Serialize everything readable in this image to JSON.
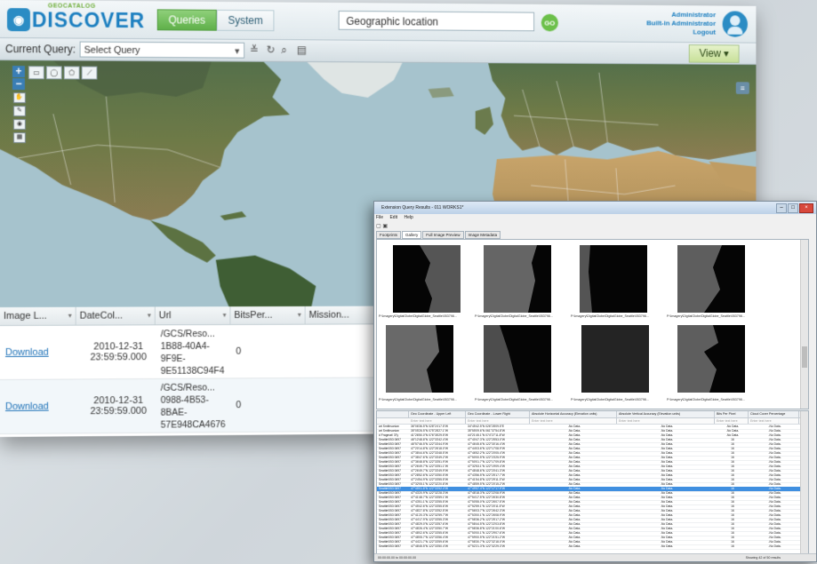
{
  "app": {
    "logo_small": "GEOCATALOG",
    "logo_main": "DISCOVER",
    "tabs": [
      {
        "label": "Queries",
        "active": true
      },
      {
        "label": "System",
        "active": false
      }
    ],
    "search_value": "Geographic location",
    "go_label": "GO",
    "user": {
      "line1": "Administrator",
      "line2": "Built-in Administrator",
      "logout": "Logout"
    }
  },
  "querybar": {
    "label": "Current Query:",
    "select_value": "Select Query",
    "view_label": "View ▾"
  },
  "grid": {
    "columns": [
      "Image L...",
      "DateCol...",
      "Url",
      "BitsPer...",
      "Mission..."
    ],
    "rows": [
      {
        "link": "Download",
        "date": "2010-12-31",
        "time": "23:59:59.000",
        "url": [
          "/GCS/Reso...",
          "1B88-40A4-",
          "9F9E-",
          "9E51138C94F4"
        ],
        "bits": "0"
      },
      {
        "link": "Download",
        "date": "2010-12-31",
        "time": "23:59:59.000",
        "url": [
          "/GCS/Reso...",
          "0988-4B53-",
          "8BAE-",
          "57E948CA4676"
        ],
        "bits": "0"
      }
    ]
  },
  "window": {
    "title": "Extension Query Results - 011 WORKS1*",
    "menu": [
      "File",
      "Edit",
      "Help"
    ],
    "tabs": [
      "Footprints",
      "Gallery",
      "Full Image Preview",
      "Image Metadata"
    ],
    "thumb_caption": "P:\\Imagery\\DigitalGlobe\\DigitalGlobe_Seattle\\053798...",
    "columns": [
      "",
      "Geo Coordinate - Upper Left",
      "Geo Coordinate - Lower Right",
      "Absolute Horizontal Accuracy (Elevation units)",
      "Absolute Vertical Accuracy (Elevation units)",
      "Bits Per Pixel",
      "Cloud Cover Percentage"
    ],
    "filter_hint": "Enter text here",
    "rows": [
      [
        "art Smithsonian",
        "36°06'36.5\"N 028°24'17.5\"W",
        "34°45'42.5\"N 026°28'09.5\"E",
        "-No Data-",
        "-No Data-",
        "-No Data-",
        "-No Data-"
      ],
      [
        "art Smithsonian",
        "35°05'26.5\"N 075°28'27.1\"W",
        "35°55'09.6\"N 061°37'54.8\"W",
        "-No Data-",
        "-No Data-",
        "-No Data-",
        "-No Data-"
      ],
      [
        "d Fragmat/ 3Ty",
        "41°26'50.0\"N 076°35'29.5\"W",
        "44°21'45.1\"N 074°27'11.8\"W",
        "-No Data-",
        "-No Data-",
        "-No Data-",
        "-No Data-"
      ],
      [
        "Seattle\\053 0697",
        "46°12'48.8\"N 122°33'42.4\"W",
        "47°40'47.3\"N 122°25'53.0\"W",
        "-No Data-",
        "-No Data-",
        "16",
        "-No Data-"
      ],
      [
        "Seattle\\053 0697",
        "46°57'46.5\"N 122°33'44.9\"W",
        "47°46'45.6\"N 122°30'16.4\"W",
        "-No Data-",
        "-No Data-",
        "16",
        "-No Data-"
      ],
      [
        "Seattle\\053 0697",
        "47°20'14.8\"N 122°26'18.0\"W",
        "47°44'03.6\"N 122°17'08.9\"W",
        "-No Data-",
        "-No Data-",
        "16",
        "-No Data-"
      ],
      [
        "Seattle\\053 0697",
        "47°38'44.6\"N 122°33'48.5\"W",
        "47°46'52.2\"N 122°20'05.4\"W",
        "-No Data-",
        "-No Data-",
        "16",
        "-No Data-"
      ],
      [
        "Seattle\\053 0697",
        "47°38'47.6\"N 122°33'49.2\"W",
        "47°50'00.5\"N 122°23'25.9\"W",
        "-No Data-",
        "-No Data-",
        "16",
        "-No Data-"
      ],
      [
        "Seattle\\053 0697",
        "47°36'48.8\"N 122°33'51.9\"W",
        "47°50'01.7\"N 122°17'09.8\"W",
        "-No Data-",
        "-No Data-",
        "16",
        "-No Data-"
      ],
      [
        "Seattle\\053 0697",
        "47°26'49.7\"N 122°33'51.1\"W",
        "47°32'53.1\"N 122°19'09.4\"W",
        "-No Data-",
        "-No Data-",
        "16",
        "-No Data-"
      ],
      [
        "Seattle\\053 0697",
        "47°26'49.7\"N 122°33'49.9\"W",
        "47°48'48.6\"N 122°20'41.3\"W",
        "-No Data-",
        "-No Data-",
        "16",
        "-No Data-"
      ],
      [
        "Seattle\\053 0697",
        "47°28'52.6\"N 122°33'50.5\"W",
        "47°43'56.5\"N 122°25'17.7\"W",
        "-No Data-",
        "-No Data-",
        "16",
        "-No Data-"
      ],
      [
        "Seattle\\053 0697",
        "47°24'54.9\"N 122°33'55.5\"W",
        "47°41'54.8\"N 122°29'11.3\"W",
        "-No Data-",
        "-No Data-",
        "16",
        "-No Data-"
      ],
      [
        "Seattle\\053 0697",
        "47°32'05.1\"N 122°32'20.8\"W",
        "47°48'59.5\"N 122°20'15.2\"W",
        "-No Data-",
        "-No Data-",
        "16",
        "-No Data-"
      ],
      [
        "Seattle\\053 0697",
        "47°45'01.8\"N 122°33'52.4\"W",
        "47°49'57.4\"N 122°17'17.9\"W",
        "-No Data-",
        "-No Data-",
        "16",
        "-No Data-"
      ],
      [
        "Seattle\\053 0697",
        "47°43'20.9\"N 122°32'28.3\"W",
        "47°48'18.3\"N 122°22'08.9\"W",
        "-No Data-",
        "-No Data-",
        "16",
        "-No Data-"
      ],
      [
        "Seattle\\053 0697",
        "47°41'48.7\"N 122°33'59.1\"W",
        "47°54'17.5\"N 122°26'30.8\"W",
        "-No Data-",
        "-No Data-",
        "16",
        "-No Data-"
      ],
      [
        "Seattle\\053 0697",
        "47°43'51.1\"N 122°33'55.5\"W",
        "47°50'55.0\"N 122°26'07.5\"W",
        "-No Data-",
        "-No Data-",
        "16",
        "-No Data-"
      ],
      [
        "Seattle\\053 0697",
        "47°45'42.6\"N 122°33'55.6\"W",
        "47°52'59.1\"N 122°20'11.5\"W",
        "-No Data-",
        "-No Data-",
        "16",
        "-No Data-"
      ],
      [
        "Seattle\\053 0697",
        "47°48'27.8\"N 122°33'52.5\"W",
        "47°56'03.7\"N 122°26'42.3\"W",
        "-No Data-",
        "-No Data-",
        "16",
        "-No Data-"
      ],
      [
        "Seattle\\053 0697",
        "47°41'20.3\"N 122°32'59.7\"W",
        "47°53'00.1\"N 122°26'08.9\"W",
        "-No Data-",
        "-No Data-",
        "16",
        "-No Data-"
      ],
      [
        "Seattle\\053 0697",
        "47°44'17.9\"N 122°33'55.3\"W",
        "47°58'36.2\"N 122°25'17.2\"W",
        "-No Data-",
        "-No Data-",
        "16",
        "-No Data-"
      ],
      [
        "Seattle\\053 0697",
        "47°48'29.0\"N 122°33'57.6\"W",
        "47°58'44.5\"N 122°22'03.8\"W",
        "-No Data-",
        "-No Data-",
        "16",
        "-No Data-"
      ],
      [
        "Seattle\\053 0697",
        "47°48'26.4\"N 122°33'50.7\"W",
        "47°58'36.8\"N 122°21'00.6\"W",
        "-No Data-",
        "-No Data-",
        "16",
        "-No Data-"
      ],
      [
        "Seattle\\053 0697",
        "47°48'02.6\"N 122°33'55.6\"W",
        "47°50'00.1\"N 122°29'07.6\"W",
        "-No Data-",
        "-No Data-",
        "16",
        "-No Data-"
      ],
      [
        "Seattle\\053 0697",
        "47°48'05.7\"N 122°33'56.4\"W",
        "47°59'00.5\"N 122°21'51.2\"W",
        "-No Data-",
        "-No Data-",
        "16",
        "-No Data-"
      ],
      [
        "Seattle\\053 0697",
        "47°44'21.7\"N 122°33'59.6\"W",
        "47°58'30.7\"N 122°32'18.0\"W",
        "-No Data-",
        "-No Data-",
        "16",
        "-No Data-"
      ],
      [
        "Seattle\\053 0697",
        "47°48'45.5\"N 122°33'50.4\"W",
        "47°52'21.3\"N 122°32'29.3\"W",
        "-No Data-",
        "-No Data-",
        "16",
        "-No Data-"
      ]
    ],
    "selected_row": 14,
    "status_left": "00:00:00.00 to 00:00:00.00",
    "status_right": "Showing 42 of 50 results"
  }
}
